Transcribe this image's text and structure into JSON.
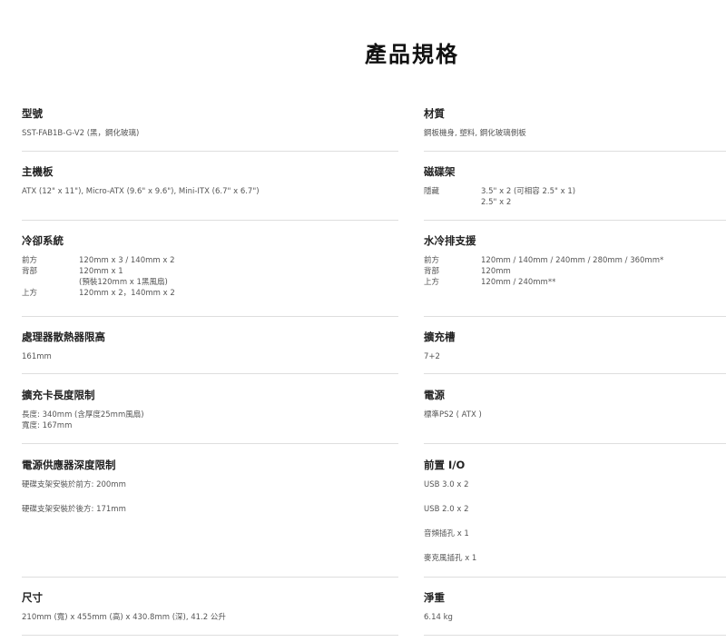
{
  "page_title": "產品規格",
  "specs": {
    "model": {
      "label": "型號",
      "value": "SST-FAB1B-G-V2 (黑，鋼化玻璃)"
    },
    "material": {
      "label": "材質",
      "value": "鋼板機身, 塑料, 鋼化玻璃側板"
    },
    "motherboard": {
      "label": "主機板",
      "value": "ATX (12\" x 11\"), Micro-ATX (9.6\" x 9.6\"), Mini-ITX (6.7\" x 6.7\")"
    },
    "drive_bays": {
      "label": "磁碟架",
      "rows": [
        {
          "k": "隱藏",
          "v": "3.5\" x 2 (可相容 2.5\" x 1)"
        },
        {
          "k": "",
          "v": "2.5\" x 2"
        }
      ]
    },
    "cooling": {
      "label": "冷卻系統",
      "rows": [
        {
          "k": "前方",
          "v": "120mm x 3 / 140mm x 2"
        },
        {
          "k": "背部",
          "v": "120mm x 1"
        },
        {
          "k": "",
          "v": "(預裝120mm x 1黑風扇)"
        },
        {
          "k": "上方",
          "v": "120mm x 2，140mm x 2"
        }
      ]
    },
    "radiator": {
      "label": "水冷排支援",
      "rows": [
        {
          "k": "前方",
          "v": "120mm / 140mm / 240mm / 280mm / 360mm*"
        },
        {
          "k": "背部",
          "v": "120mm"
        },
        {
          "k": "上方",
          "v": "120mm / 240mm**"
        }
      ]
    },
    "cpu_cooler": {
      "label": "處理器散熱器限高",
      "value": "161mm"
    },
    "expansion_slots": {
      "label": "擴充槽",
      "value": "7+2"
    },
    "gpu_length": {
      "label": "擴充卡長度限制",
      "lines": [
        "長度: 340mm (含厚度25mm風扇)",
        "寬度: 167mm"
      ]
    },
    "psu": {
      "label": "電源",
      "value": "標準PS2 ( ATX )"
    },
    "psu_depth": {
      "label": "電源供應器深度限制",
      "lines": [
        "硬碟支架安裝於前方: 200mm",
        "硬碟支架安裝於後方: 171mm"
      ]
    },
    "front_io": {
      "label": "前置 I/O",
      "lines": [
        "USB 3.0 x 2",
        "USB 2.0 x 2",
        "音頻插孔 x 1",
        "麥克風插孔 x 1"
      ]
    },
    "dimensions": {
      "label": "尺寸",
      "value": "210mm (寬) x 455mm (高) x 430.8mm (深), 41.2 公升"
    },
    "net_weight": {
      "label": "淨重",
      "value": "6.14 kg"
    }
  }
}
